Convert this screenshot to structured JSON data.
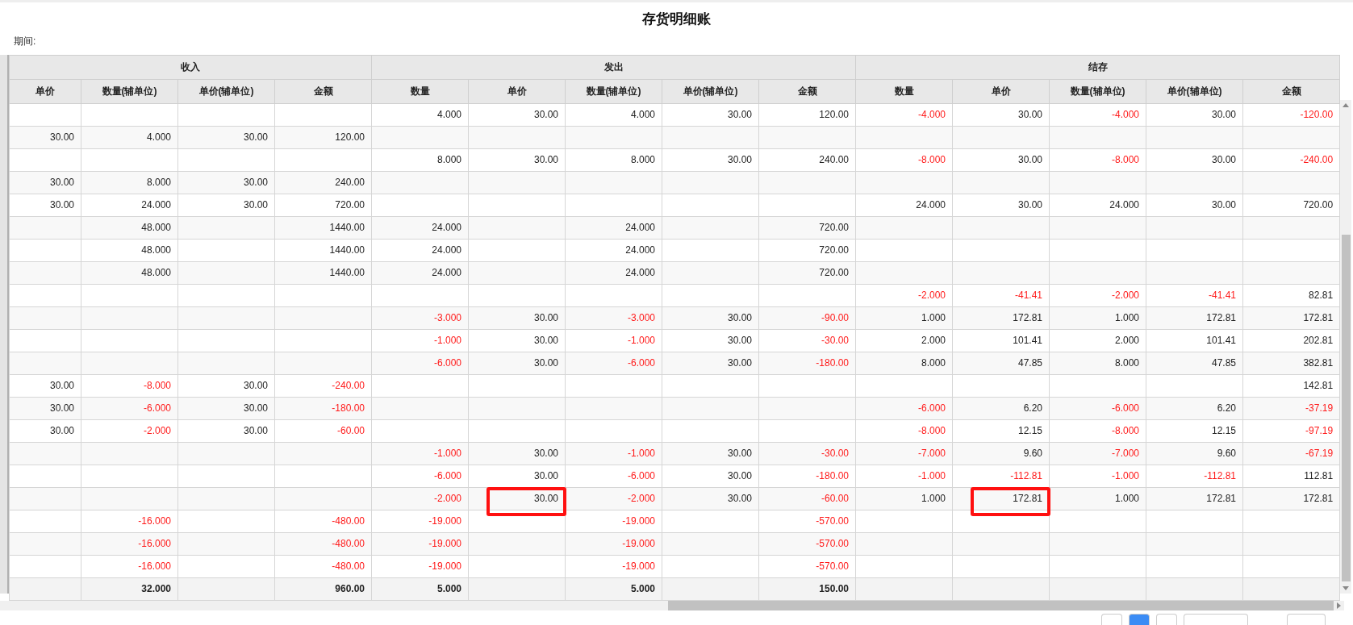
{
  "title": "存货明细账",
  "period_label": "期间:",
  "column_groups": [
    {
      "label": "收入",
      "columns": [
        "单价",
        "数量(辅单位)",
        "单价(辅单位)",
        "金额"
      ]
    },
    {
      "label": "发出",
      "columns": [
        "数量",
        "单价",
        "数量(辅单位)",
        "单价(辅单位)",
        "金额"
      ]
    },
    {
      "label": "结存",
      "columns": [
        "数量",
        "单价",
        "数量(辅单位)",
        "单价(辅单位)",
        "金额"
      ]
    }
  ],
  "rows": [
    {
      "out_qty": "4.000",
      "out_price": "30.00",
      "out_qty_aux": "4.000",
      "out_price_aux": "30.00",
      "out_amount": "120.00",
      "bal_qty": {
        "t": "-4.000",
        "neg": true
      },
      "bal_price": "30.00",
      "bal_qty_aux": {
        "t": "-4.000",
        "neg": true
      },
      "bal_price_aux": "30.00",
      "bal_amount": {
        "t": "-120.00",
        "neg": true
      }
    },
    {
      "in_price": "30.00",
      "in_qty_aux": "4.000",
      "in_price_aux": "30.00",
      "in_amount": "120.00"
    },
    {
      "out_qty": "8.000",
      "out_price": "30.00",
      "out_qty_aux": "8.000",
      "out_price_aux": "30.00",
      "out_amount": "240.00",
      "bal_qty": {
        "t": "-8.000",
        "neg": true
      },
      "bal_price": "30.00",
      "bal_qty_aux": {
        "t": "-8.000",
        "neg": true
      },
      "bal_price_aux": "30.00",
      "bal_amount": {
        "t": "-240.00",
        "neg": true
      }
    },
    {
      "in_price": "30.00",
      "in_qty_aux": "8.000",
      "in_price_aux": "30.00",
      "in_amount": "240.00"
    },
    {
      "in_price": "30.00",
      "in_qty_aux": "24.000",
      "in_price_aux": "30.00",
      "in_amount": "720.00",
      "bal_qty": "24.000",
      "bal_price": "30.00",
      "bal_qty_aux": "24.000",
      "bal_price_aux": "30.00",
      "bal_amount": "720.00"
    },
    {
      "in_qty_aux": "48.000",
      "in_amount": "1440.00",
      "out_qty": "24.000",
      "out_qty_aux": "24.000",
      "out_amount": "720.00"
    },
    {
      "in_qty_aux": "48.000",
      "in_amount": "1440.00",
      "out_qty": "24.000",
      "out_qty_aux": "24.000",
      "out_amount": "720.00"
    },
    {
      "in_qty_aux": "48.000",
      "in_amount": "1440.00",
      "out_qty": "24.000",
      "out_qty_aux": "24.000",
      "out_amount": "720.00"
    },
    {
      "bal_qty": {
        "t": "-2.000",
        "neg": true
      },
      "bal_price": {
        "t": "-41.41",
        "neg": true
      },
      "bal_qty_aux": {
        "t": "-2.000",
        "neg": true
      },
      "bal_price_aux": {
        "t": "-41.41",
        "neg": true
      },
      "bal_amount": "82.81"
    },
    {
      "out_qty": {
        "t": "-3.000",
        "neg": true
      },
      "out_price": "30.00",
      "out_qty_aux": {
        "t": "-3.000",
        "neg": true
      },
      "out_price_aux": "30.00",
      "out_amount": {
        "t": "-90.00",
        "neg": true
      },
      "bal_qty": "1.000",
      "bal_price": "172.81",
      "bal_qty_aux": "1.000",
      "bal_price_aux": "172.81",
      "bal_amount": "172.81"
    },
    {
      "out_qty": {
        "t": "-1.000",
        "neg": true
      },
      "out_price": "30.00",
      "out_qty_aux": {
        "t": "-1.000",
        "neg": true
      },
      "out_price_aux": "30.00",
      "out_amount": {
        "t": "-30.00",
        "neg": true
      },
      "bal_qty": "2.000",
      "bal_price": "101.41",
      "bal_qty_aux": "2.000",
      "bal_price_aux": "101.41",
      "bal_amount": "202.81"
    },
    {
      "out_qty": {
        "t": "-6.000",
        "neg": true
      },
      "out_price": "30.00",
      "out_qty_aux": {
        "t": "-6.000",
        "neg": true
      },
      "out_price_aux": "30.00",
      "out_amount": {
        "t": "-180.00",
        "neg": true
      },
      "bal_qty": "8.000",
      "bal_price": "47.85",
      "bal_qty_aux": "8.000",
      "bal_price_aux": "47.85",
      "bal_amount": "382.81"
    },
    {
      "in_price": "30.00",
      "in_qty_aux": {
        "t": "-8.000",
        "neg": true
      },
      "in_price_aux": "30.00",
      "in_amount": {
        "t": "-240.00",
        "neg": true
      },
      "bal_amount": "142.81"
    },
    {
      "in_price": "30.00",
      "in_qty_aux": {
        "t": "-6.000",
        "neg": true
      },
      "in_price_aux": "30.00",
      "in_amount": {
        "t": "-180.00",
        "neg": true
      },
      "bal_qty": {
        "t": "-6.000",
        "neg": true
      },
      "bal_price": "6.20",
      "bal_qty_aux": {
        "t": "-6.000",
        "neg": true
      },
      "bal_price_aux": "6.20",
      "bal_amount": {
        "t": "-37.19",
        "neg": true
      }
    },
    {
      "in_price": "30.00",
      "in_qty_aux": {
        "t": "-2.000",
        "neg": true
      },
      "in_price_aux": "30.00",
      "in_amount": {
        "t": "-60.00",
        "neg": true
      },
      "bal_qty": {
        "t": "-8.000",
        "neg": true
      },
      "bal_price": "12.15",
      "bal_qty_aux": {
        "t": "-8.000",
        "neg": true
      },
      "bal_price_aux": "12.15",
      "bal_amount": {
        "t": "-97.19",
        "neg": true
      }
    },
    {
      "out_qty": {
        "t": "-1.000",
        "neg": true
      },
      "out_price": "30.00",
      "out_qty_aux": {
        "t": "-1.000",
        "neg": true
      },
      "out_price_aux": "30.00",
      "out_amount": {
        "t": "-30.00",
        "neg": true
      },
      "bal_qty": {
        "t": "-7.000",
        "neg": true
      },
      "bal_price": "9.60",
      "bal_qty_aux": {
        "t": "-7.000",
        "neg": true
      },
      "bal_price_aux": "9.60",
      "bal_amount": {
        "t": "-67.19",
        "neg": true
      }
    },
    {
      "out_qty": {
        "t": "-6.000",
        "neg": true
      },
      "out_price": "30.00",
      "out_qty_aux": {
        "t": "-6.000",
        "neg": true
      },
      "out_price_aux": "30.00",
      "out_amount": {
        "t": "-180.00",
        "neg": true
      },
      "bal_qty": {
        "t": "-1.000",
        "neg": true
      },
      "bal_price": {
        "t": "-112.81",
        "neg": true
      },
      "bal_qty_aux": {
        "t": "-1.000",
        "neg": true
      },
      "bal_price_aux": {
        "t": "-112.81",
        "neg": true
      },
      "bal_amount": "112.81"
    },
    {
      "out_qty": {
        "t": "-2.000",
        "neg": true
      },
      "out_price": {
        "t": "30.00",
        "highlighted": true
      },
      "out_qty_aux": {
        "t": "-2.000",
        "neg": true
      },
      "out_price_aux": "30.00",
      "out_amount": {
        "t": "-60.00",
        "neg": true
      },
      "bal_qty": "1.000",
      "bal_price": {
        "t": "172.81",
        "highlighted": true
      },
      "bal_qty_aux": "1.000",
      "bal_price_aux": "172.81",
      "bal_amount": "172.81"
    },
    {
      "in_qty_aux": {
        "t": "-16.000",
        "neg": true
      },
      "in_amount": {
        "t": "-480.00",
        "neg": true
      },
      "out_qty": {
        "t": "-19.000",
        "neg": true
      },
      "out_qty_aux": {
        "t": "-19.000",
        "neg": true
      },
      "out_amount": {
        "t": "-570.00",
        "neg": true
      }
    },
    {
      "in_qty_aux": {
        "t": "-16.000",
        "neg": true
      },
      "in_amount": {
        "t": "-480.00",
        "neg": true
      },
      "out_qty": {
        "t": "-19.000",
        "neg": true
      },
      "out_qty_aux": {
        "t": "-19.000",
        "neg": true
      },
      "out_amount": {
        "t": "-570.00",
        "neg": true
      }
    },
    {
      "in_qty_aux": {
        "t": "-16.000",
        "neg": true
      },
      "in_amount": {
        "t": "-480.00",
        "neg": true
      },
      "out_qty": {
        "t": "-19.000",
        "neg": true
      },
      "out_qty_aux": {
        "t": "-19.000",
        "neg": true
      },
      "out_amount": {
        "t": "-570.00",
        "neg": true
      }
    }
  ],
  "total_row": {
    "in_qty_aux": "32.000",
    "in_amount": "960.00",
    "out_qty": "5.000",
    "out_qty_aux": "5.000",
    "out_amount": "150.00"
  }
}
